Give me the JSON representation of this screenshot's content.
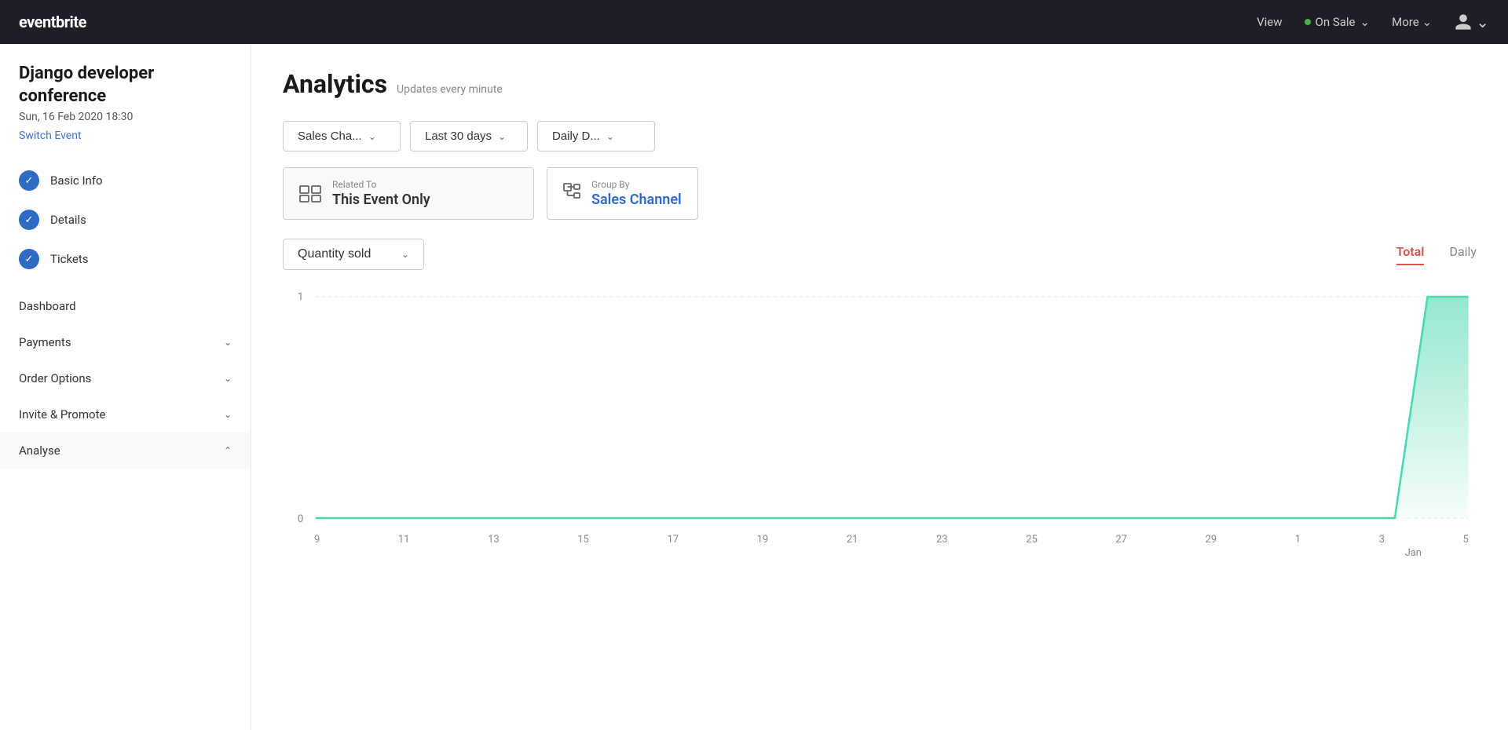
{
  "topnav": {
    "logo": "eventbrite",
    "view_label": "View",
    "status_label": "On Sale",
    "more_label": "More",
    "user_icon": "account"
  },
  "sidebar": {
    "event_name": "Django developer conference",
    "event_date": "Sun, 16 Feb 2020 18:30",
    "switch_event_label": "Switch Event",
    "items": [
      {
        "label": "Basic Info",
        "checked": true
      },
      {
        "label": "Details",
        "checked": true
      },
      {
        "label": "Tickets",
        "checked": true
      }
    ],
    "expandable_items": [
      {
        "label": "Dashboard"
      },
      {
        "label": "Payments"
      },
      {
        "label": "Order Options"
      },
      {
        "label": "Invite & Promote"
      },
      {
        "label": "Analyse",
        "expanded": true
      }
    ]
  },
  "analytics": {
    "page_title": "Analytics",
    "page_subtitle": "Updates every minute",
    "filters": {
      "channel": "Sales Cha...",
      "period": "Last 30 days",
      "breakdown": "Daily D..."
    },
    "related_to": {
      "label": "Related To",
      "value": "This Event Only"
    },
    "group_by": {
      "label": "Group By",
      "value": "Sales Channel"
    },
    "metric": {
      "label": "Quantity sold"
    },
    "view_tabs": [
      {
        "label": "Total",
        "active": true
      },
      {
        "label": "Daily",
        "active": false
      }
    ],
    "chart": {
      "y_max": 1,
      "y_min": 0,
      "x_labels": [
        "9",
        "11",
        "13",
        "15",
        "17",
        "19",
        "21",
        "23",
        "25",
        "27",
        "29",
        "1",
        "3",
        "5"
      ],
      "jan_label": "Jan"
    }
  }
}
